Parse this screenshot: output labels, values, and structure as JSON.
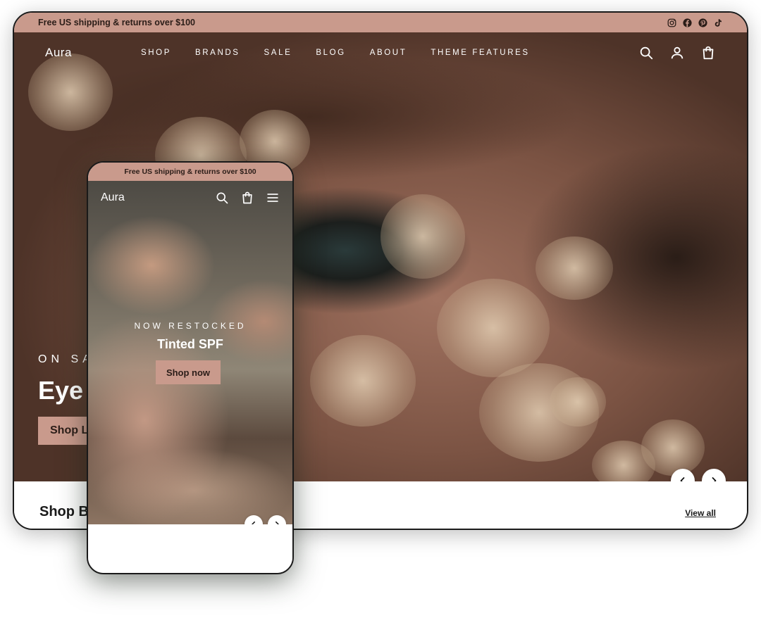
{
  "desktop": {
    "announcement": "Free US shipping & returns over $100",
    "social_icons": [
      "instagram-icon",
      "facebook-icon",
      "pinterest-icon",
      "tiktok-icon"
    ],
    "logo": "Aura",
    "nav": [
      "SHOP",
      "BRANDS",
      "SALE",
      "BLOG",
      "ABOUT",
      "THEME FEATURES"
    ],
    "header_icons": [
      "search-icon",
      "account-icon",
      "cart-icon"
    ],
    "hero": {
      "eyebrow": "ON SAL",
      "title": "Eye C",
      "cta": "Shop Li"
    },
    "section_title": "Shop B",
    "view_all": "View all"
  },
  "mobile": {
    "announcement": "Free US shipping & returns over $100",
    "logo": "Aura",
    "header_icons": [
      "search-icon",
      "cart-icon",
      "menu-icon"
    ],
    "hero": {
      "eyebrow": "NOW RESTOCKED",
      "title": "Tinted SPF",
      "cta": "Shop now"
    }
  },
  "colors": {
    "accent": "#c99a8c",
    "text_dark": "#2b1d18"
  }
}
